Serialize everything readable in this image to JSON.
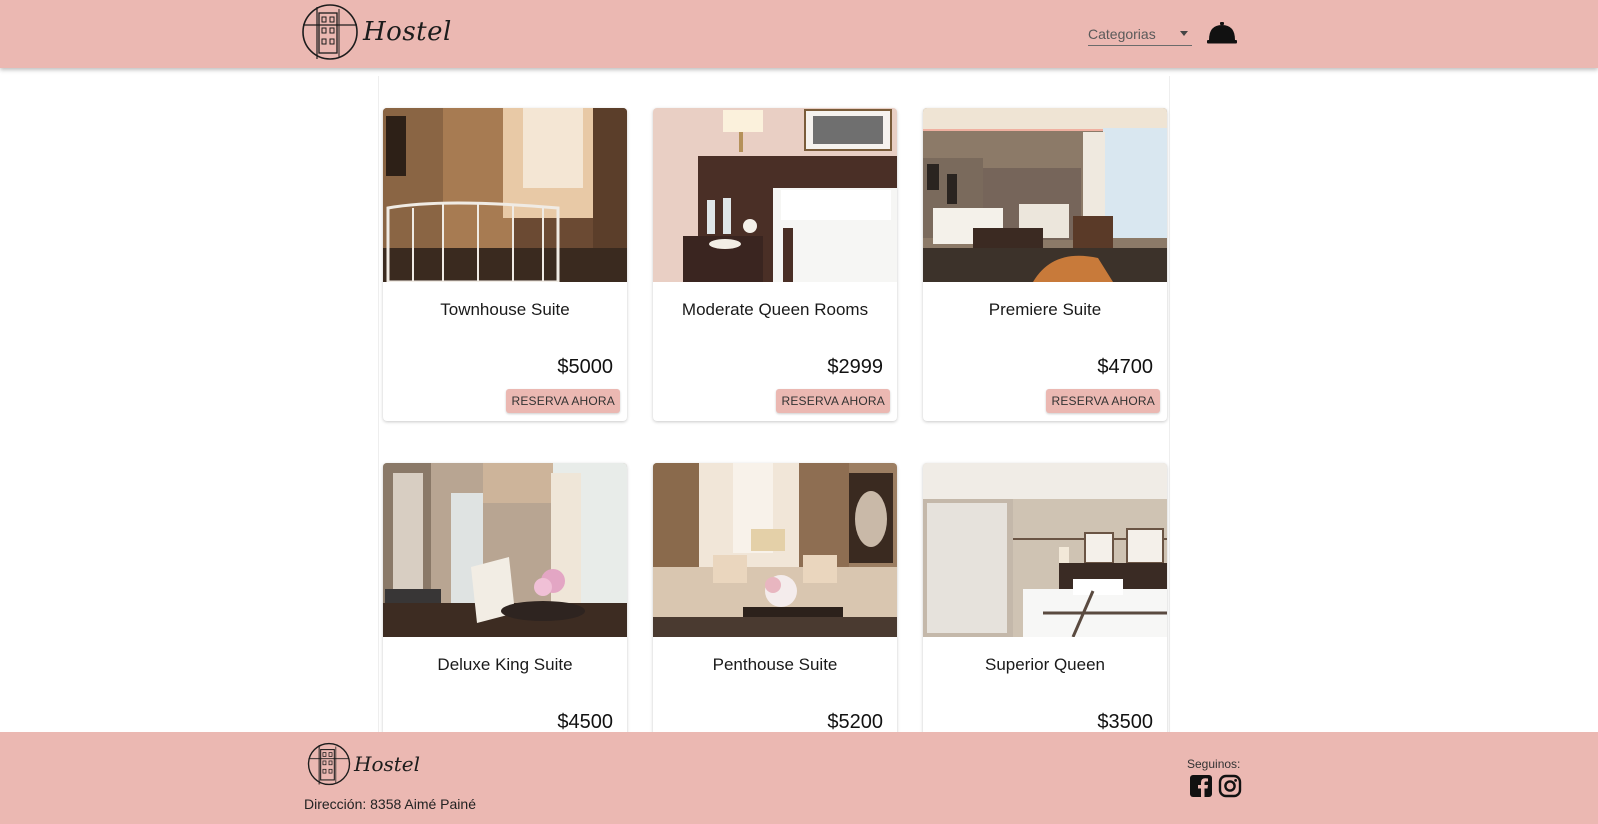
{
  "header": {
    "logo_text": "Hostel",
    "categories_label": "Categorias"
  },
  "rooms": [
    {
      "name": "Townhouse Suite",
      "price": "$5000",
      "button": "RESERVA AHORA"
    },
    {
      "name": "Moderate Queen Rooms",
      "price": "$2999",
      "button": "RESERVA AHORA"
    },
    {
      "name": "Premiere Suite",
      "price": "$4700",
      "button": "RESERVA AHORA"
    },
    {
      "name": "Deluxe King Suite",
      "price": "$4500"
    },
    {
      "name": "Penthouse Suite",
      "price": "$5200"
    },
    {
      "name": "Superior Queen",
      "price": "$3500"
    }
  ],
  "footer": {
    "logo_text": "Hostel",
    "address": "Dirección: 8358 Aimé Painé",
    "follow_label": "Seguinos:",
    "social_icons": [
      "facebook-icon",
      "instagram-icon"
    ]
  },
  "colors": {
    "brand": "#ebb8b2"
  }
}
